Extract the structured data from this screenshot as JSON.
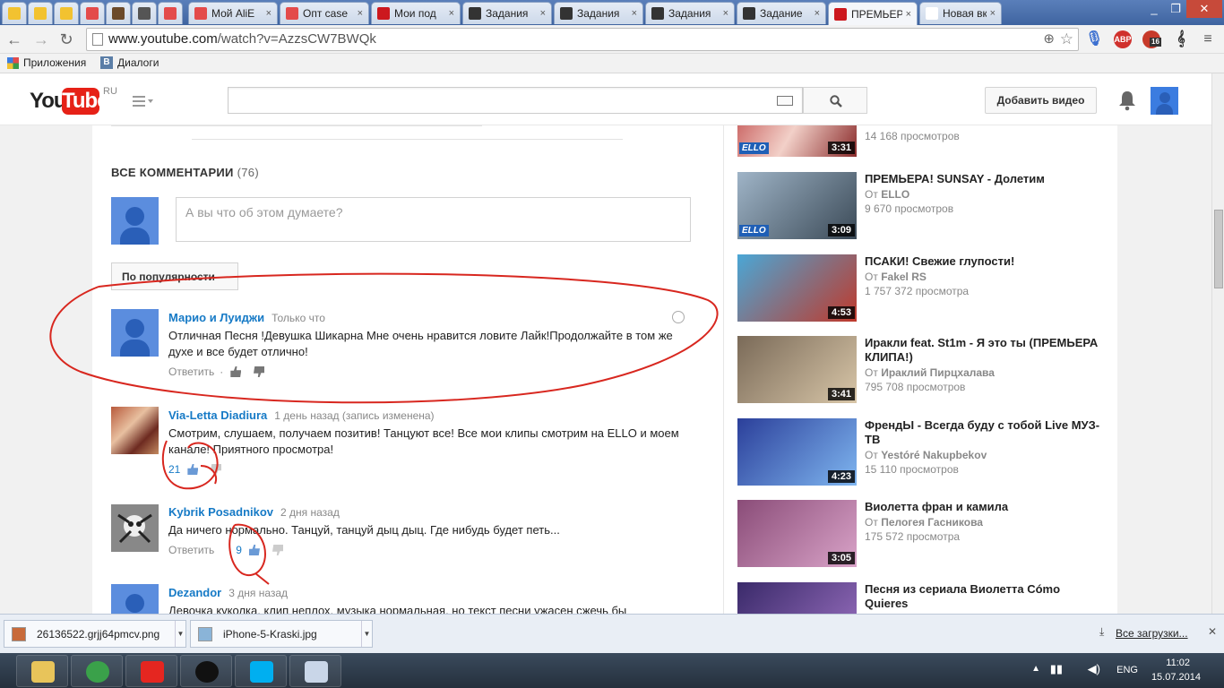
{
  "browser": {
    "tabs": [
      {
        "label": "",
        "color": "#f2c230"
      },
      {
        "label": "",
        "color": "#f2c230"
      },
      {
        "label": "",
        "color": "#f2c230"
      },
      {
        "label": "",
        "color": "#e34b4b"
      },
      {
        "label": "",
        "color": "#6b4a2a"
      },
      {
        "label": "",
        "color": "#555555"
      },
      {
        "label": "",
        "color": "#e34b4b"
      },
      {
        "label": "Мой AliE",
        "color": "#e34b4b"
      },
      {
        "label": "Опт case",
        "color": "#e34b4b"
      },
      {
        "label": "Мои под",
        "color": "#cc181e"
      },
      {
        "label": "Задания",
        "color": "#333333"
      },
      {
        "label": "Задания",
        "color": "#333333"
      },
      {
        "label": "Задания",
        "color": "#333333"
      },
      {
        "label": "Задание",
        "color": "#333333"
      },
      {
        "label": "ПРЕМЬЕР",
        "color": "#cc181e",
        "active": true
      },
      {
        "label": "Новая вклад",
        "color": "#ffffff"
      }
    ],
    "url_host": "www.youtube.com",
    "url_path": "/watch?v=AzzsCW7BWQk",
    "extension_badge": "16",
    "abp_label": "ABP"
  },
  "bookmarks": [
    {
      "label": "Приложения"
    },
    {
      "label": "Диалоги"
    }
  ],
  "header": {
    "logo_you": "You",
    "logo_tube": "Tube",
    "logo_region": "RU",
    "search_placeholder": "",
    "upload_label": "Добавить видео"
  },
  "comments": {
    "title": "ВСЕ КОММЕНТАРИИ",
    "count": "(76)",
    "share_placeholder": "А вы что об этом думаете?",
    "sort_label": "По популярности",
    "items": [
      {
        "author": "Марио и Луиджи",
        "time": "Только что",
        "text": "Отличная Песня !Девушка Шикарна Мне очень нравится ловите Лайк!Продолжайте в том же духе и все будет отлично!",
        "reply": "Ответить",
        "separator": "·",
        "likes": ""
      },
      {
        "author": "Via-Letta Diadiura",
        "time": "1 день назад (запись изменена)",
        "text": "Смотрим, слушаем, получаем позитив! Танцуют все! Все мои клипы смотрим на ELLO и моем канале! Приятного просмотра!",
        "reply": "",
        "likes": "21"
      },
      {
        "author": "Kybrik Posadnikov",
        "time": "2 дня назад",
        "text": "Да ничего нормально. Танцуй, танцуй дыц дыц. Где нибудь будет петь...",
        "reply": "Ответить",
        "likes": "9"
      },
      {
        "author": "Dezandor",
        "time": "3 дня назад",
        "text": "Девочка куколка, клип неплох, музыка нормальная, но текст песни ужасен сжечь бы",
        "reply": "",
        "likes": ""
      }
    ]
  },
  "sidebar": {
    "top_views": "14 168 просмотров",
    "top_duration": "3:31",
    "videos": [
      {
        "title": "ПРЕМЬЕРА! SUNSAY - Долетим",
        "from": "От",
        "channel": "ELLO",
        "views": "9 670 просмотров",
        "duration": "3:09",
        "badge": "ELLO",
        "colors": [
          "#9fb4c7",
          "#3b4a57"
        ]
      },
      {
        "title": "ПСАКИ! Свежие глупости!",
        "from": "От",
        "channel": "Fakel RS",
        "views": "1 757 372 просмотра",
        "duration": "4:53",
        "badge": "",
        "colors": [
          "#4aa7d6",
          "#c0392b"
        ]
      },
      {
        "title": "Иракли feat. St1m - Я это ты (ПРЕМЬЕРА КЛИПА!)",
        "from": "От",
        "channel": "Ираклий Пирцхалава",
        "views": "795 708 просмотров",
        "duration": "3:41",
        "badge": "",
        "colors": [
          "#7a6a58",
          "#d8c6a8"
        ]
      },
      {
        "title": "ФрендЫ - Всегда буду с тобой Live МУЗ-ТВ",
        "from": "От",
        "channel": "Yestóré Nakupbekov",
        "views": "15 110 просмотров",
        "duration": "4:23",
        "badge": "",
        "colors": [
          "#2b3f9a",
          "#7fb6f0"
        ]
      },
      {
        "title": "Виолетта фран и камила",
        "from": "От",
        "channel": "Пелогея Гасникова",
        "views": "175 572 просмотра",
        "duration": "3:05",
        "badge": "",
        "colors": [
          "#8a4c78",
          "#d9a3c8"
        ]
      },
      {
        "title": "Песня из сериала Виолетта Cómo Quieres",
        "from": "",
        "channel": "",
        "views": "",
        "duration": "",
        "badge": "",
        "colors": [
          "#3a2a6a",
          "#9a70c0"
        ]
      }
    ]
  },
  "downloads": {
    "items": [
      {
        "name": "26136522.grjj64pmcv.png"
      },
      {
        "name": "iPhone-5-Kraski.jpg"
      }
    ],
    "all_label": "Все загрузки..."
  },
  "taskbar": {
    "apps": [
      {
        "name": "explorer",
        "color": "#e8c45a"
      },
      {
        "name": "chrome",
        "color": "#3aa14a"
      },
      {
        "name": "yandex",
        "color": "#e52620"
      },
      {
        "name": "recorder",
        "color": "#111111"
      },
      {
        "name": "skype",
        "color": "#00aff0"
      },
      {
        "name": "paint",
        "color": "#c9d6e8"
      }
    ],
    "lang": "ENG",
    "time": "11:02",
    "date": "15.07.2014"
  }
}
